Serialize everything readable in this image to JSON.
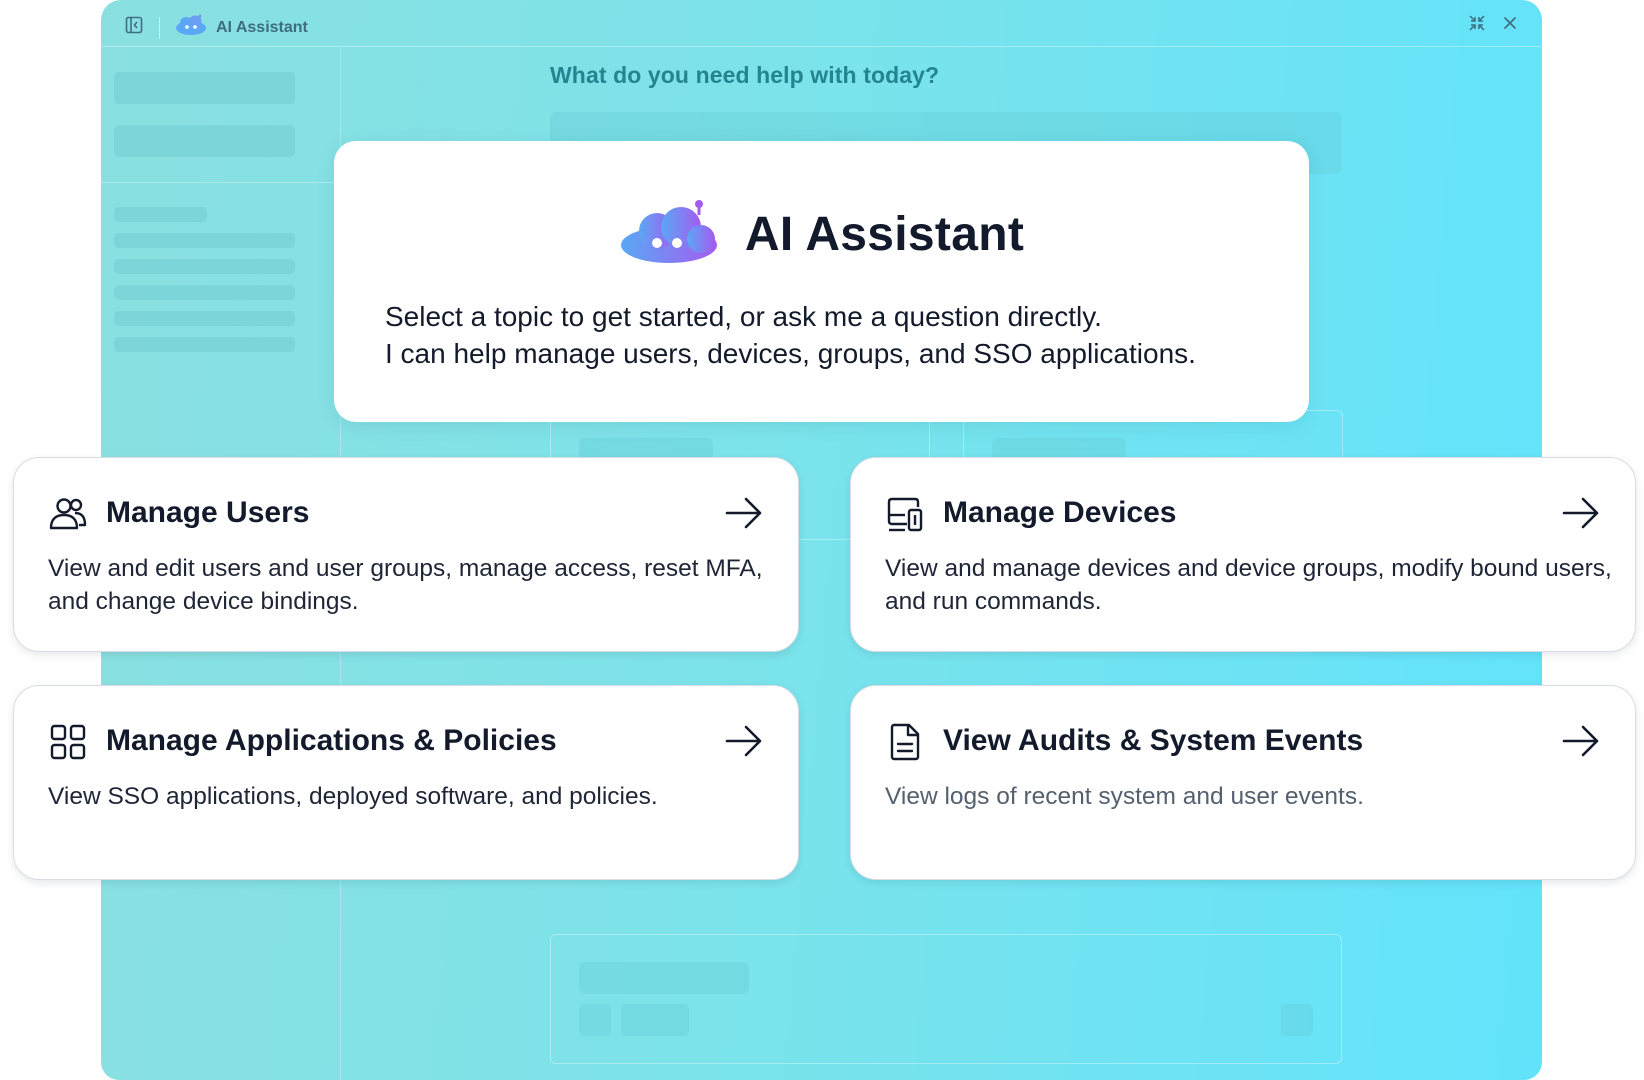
{
  "window": {
    "title": "AI Assistant",
    "icons": {
      "sidebar_toggle": "sidebar-collapse-icon",
      "app_logo": "cloud-robot-icon",
      "minimize": "collapse-arrows-icon",
      "close": "close-icon"
    }
  },
  "background": {
    "question": "What do you need help with today?"
  },
  "hero": {
    "title": "AI Assistant",
    "line1": "Select a topic to get started, or ask me a question directly.",
    "line2": "I can help manage users, devices, groups, and SSO applications.",
    "logo_icon": "cloud-robot-icon"
  },
  "topics": [
    {
      "title": "Manage Users",
      "description": "View and edit users and user groups, manage access, reset MFA, and change device bindings.",
      "icon": "users-icon"
    },
    {
      "title": "Manage Devices",
      "description": "View and manage devices and device groups, modify bound users, and run commands.",
      "icon": "devices-icon"
    },
    {
      "title": "Manage Applications & Policies",
      "description": "View SSO applications, deployed software, and policies.",
      "icon": "apps-grid-icon"
    },
    {
      "title": "View Audits & System Events",
      "description": "View logs of recent system and user events.",
      "icon": "document-icon"
    }
  ],
  "colors": {
    "bg_gradient_start": "#8ae0e0",
    "bg_gradient_end": "#62e3fb",
    "logo_blue": "#5aa8f5",
    "logo_purple": "#a45cf0",
    "text_dark": "#131a2b"
  }
}
